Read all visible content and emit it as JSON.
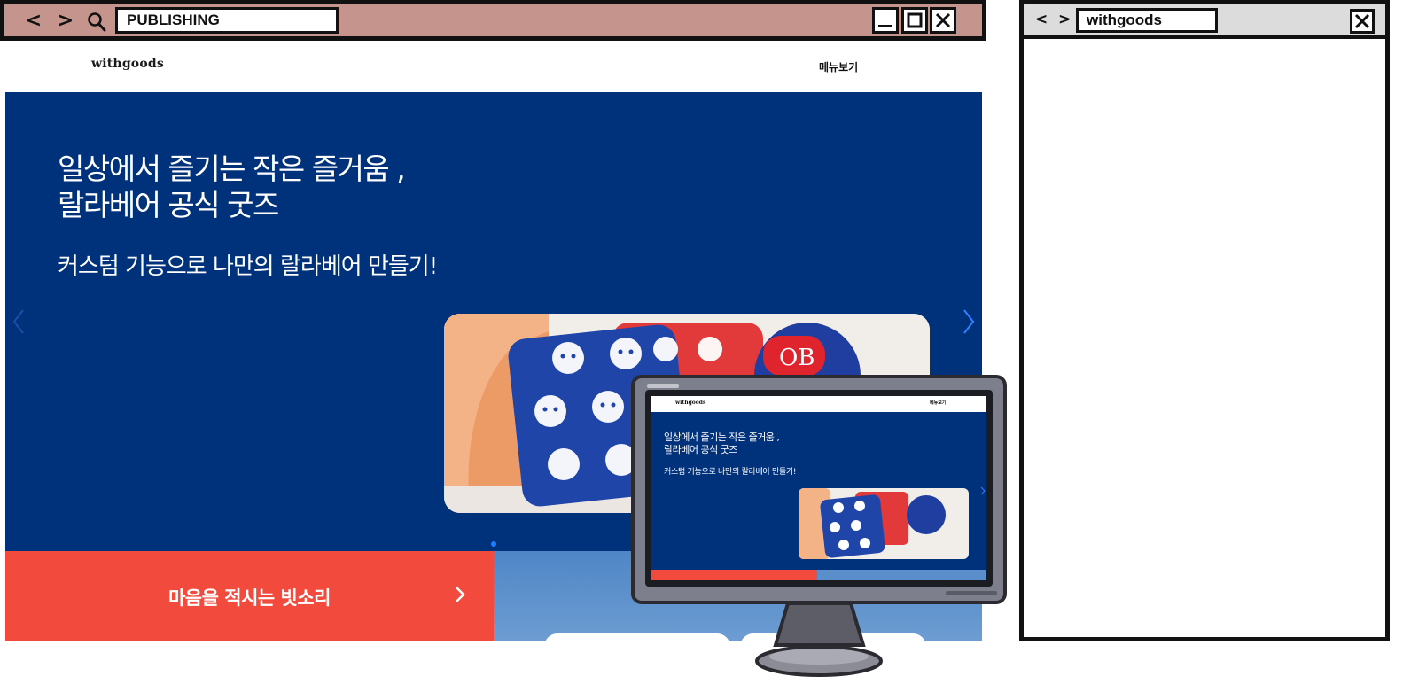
{
  "main_window": {
    "address": "PUBLISHING",
    "back_glyph": "<",
    "forward_glyph": ">",
    "icons": [
      "search-icon",
      "minimize-icon",
      "maximize-icon",
      "close-icon"
    ]
  },
  "site": {
    "logo": "withgoods",
    "menu": "메뉴보기",
    "hero": {
      "title_line1": "일상에서 즐기는 작은 즐거움 ,",
      "title_line2": "랄라베어 공식 굿즈",
      "subtitle": "커스텀 기능으로 나만의 랄라베어 만들기!"
    },
    "banner": {
      "label": "마음을 적시는 빗소리"
    }
  },
  "monitor_preview": {
    "logo": "withgoods",
    "menu": "메뉴보기",
    "title_line1": "일상에서 즐기는 작은 즐거움 ,",
    "title_line2": "랄라베어 공식 굿즈",
    "subtitle": "커스텀 기능으로 나만의 랄라베어 만들기!"
  },
  "right_window": {
    "address": "withgoods",
    "back_glyph": "<",
    "forward_glyph": ">"
  },
  "colors": {
    "titlebar": "#c4948d",
    "hero_bg": "#00317b",
    "banner_red": "#f24b3e",
    "sky_blue": "#5a8fcb",
    "accent_dot": "#1f7bff"
  }
}
